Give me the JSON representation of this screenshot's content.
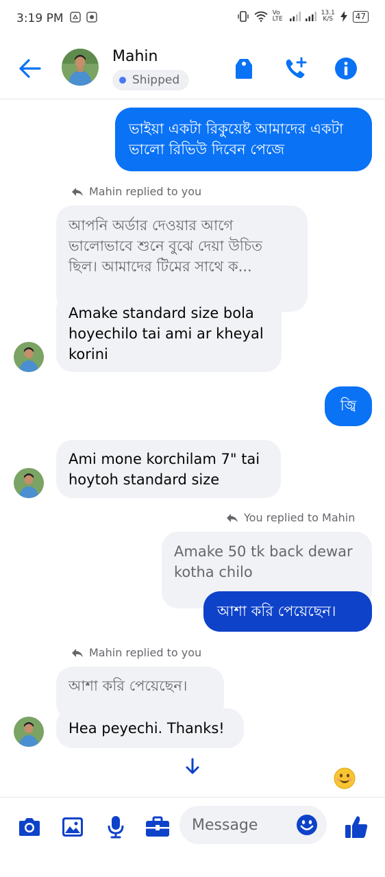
{
  "status_bar": {
    "time": "3:19 PM",
    "net_speed": "13.1",
    "net_unit": "K/S",
    "battery": "47",
    "volte": "Vo LTE"
  },
  "header": {
    "name": "Mahin",
    "status_label": "Shipped"
  },
  "messages": {
    "m1": "ভাইয়া একটা রিকুয়েষ্ট আমাদের একটা ভালো রিভিউ দিবেন পেজে",
    "reply_note_1": "Mahin replied to you",
    "quote_1": "আপনি অর্ডার দেওয়ার আগে ভালোভাবে শুনে বুঝে দেয়া উচিত ছিল। আমাদের টিমের সাথে ক...",
    "m2": "Amake standard size bola hoyechilo tai ami ar kheyal korini",
    "m3": "জ্বি",
    "m4": "Ami mone korchilam 7\" tai hoytoh standard size",
    "reply_note_2": "You replied to Mahin",
    "quote_2": "Amake 50 tk back dewar kotha chilo",
    "m5": "আশা করি পেয়েছেন।",
    "reply_note_3": "Mahin replied to you",
    "quote_3": "আশা করি পেয়েছেন।",
    "m6": "Hea peyechi. Thanks!"
  },
  "composer": {
    "placeholder": "Message"
  },
  "colors": {
    "accent": "#0a72f5",
    "outgoing_bubble": "#0a72f5",
    "outgoing_bubble_dark": "#0e42c9",
    "incoming_bubble": "#f0f2f5"
  },
  "icons": [
    "back-arrow-icon",
    "shopping-tag-icon",
    "add-call-icon",
    "info-icon",
    "reply-arrow-icon",
    "scroll-down-arrow-icon",
    "smile-emoji-icon",
    "camera-icon",
    "image-icon",
    "microphone-icon",
    "briefcase-icon",
    "emoji-icon",
    "thumbs-up-icon"
  ]
}
